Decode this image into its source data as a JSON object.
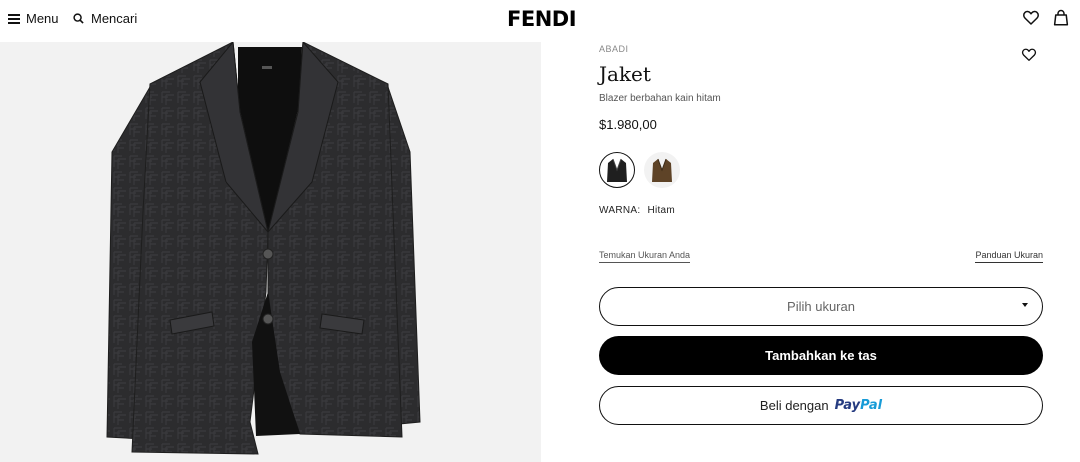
{
  "header": {
    "menu_label": "Menu",
    "search_label": "Mencari",
    "logo": "FENDI"
  },
  "product": {
    "tag": "ABADI",
    "title": "Jaket",
    "subtitle": "Blazer berbahan kain hitam",
    "price": "$1.980,00",
    "color_label": "WARNA:",
    "color_value": "Hitam",
    "find_size_link": "Temukan Ukuran Anda",
    "size_guide_link": "Panduan Ukuran",
    "size_placeholder": "Pilih ukuran",
    "add_to_bag": "Tambahkan ke tas",
    "paypal_prefix": "Beli dengan",
    "paypal_brand_1": "Pay",
    "paypal_brand_2": "Pal"
  },
  "swatches": [
    {
      "color": "#1f1f1f",
      "selected": true
    },
    {
      "color": "#5e4327",
      "selected": false
    }
  ],
  "colors": {
    "jacket": "#2b2b2d",
    "background": "#f2f2f2",
    "button_primary": "#000000",
    "paypal_dark": "#253b80",
    "paypal_light": "#179bd7"
  },
  "icons": {
    "menu": "hamburger-icon",
    "search": "search-icon",
    "wishlist": "heart-icon",
    "bag": "shopping-bag-icon"
  }
}
